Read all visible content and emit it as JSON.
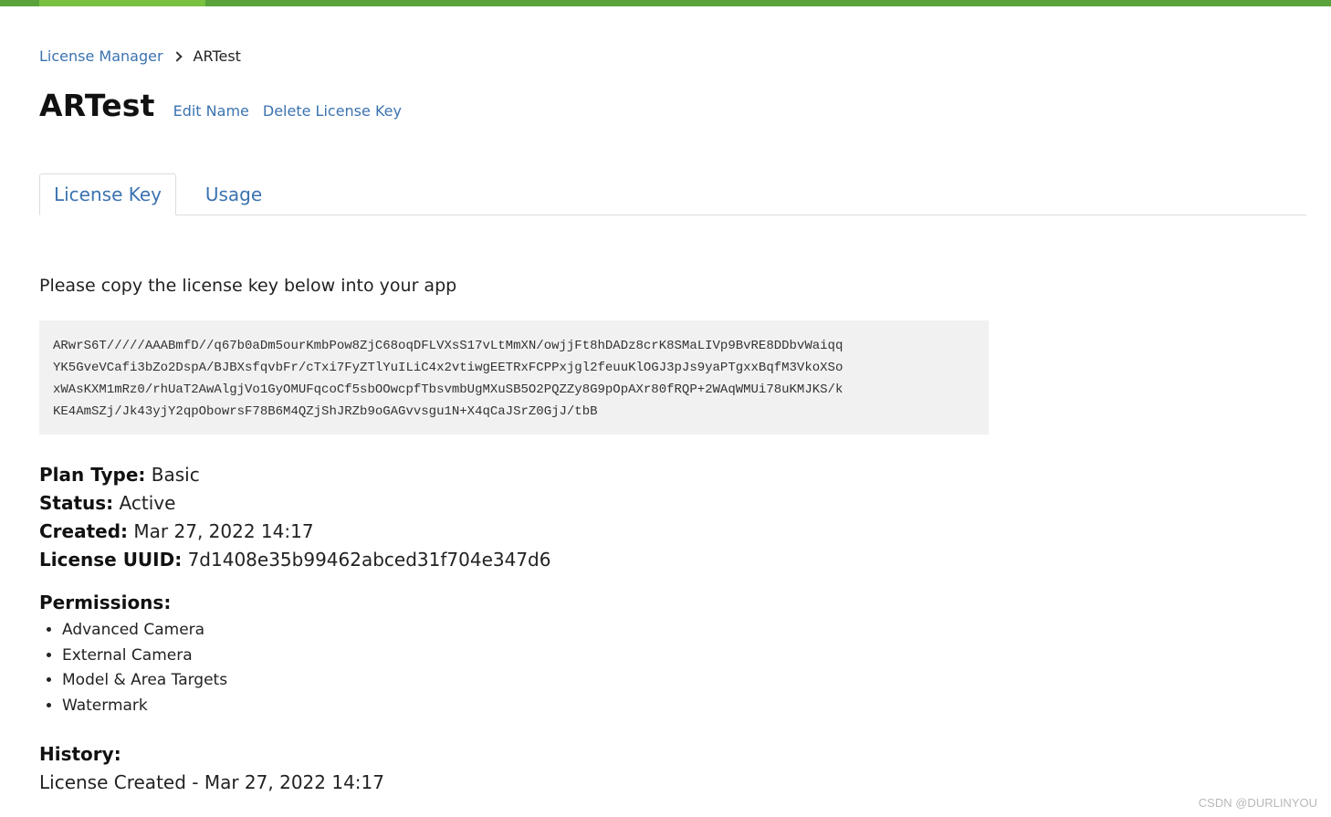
{
  "brand": {
    "accent": "#5aa33c",
    "link": "#3b73b0"
  },
  "breadcrumb": {
    "parent": "License Manager",
    "current": "ARTest"
  },
  "header": {
    "title": "ARTest",
    "edit_label": "Edit Name",
    "delete_label": "Delete License Key"
  },
  "tabs": [
    {
      "label": "License Key",
      "active": true
    },
    {
      "label": "Usage",
      "active": false
    }
  ],
  "license": {
    "instructions": "Please copy the license key below into your app",
    "key_lines": [
      "ARwrS6T/////AAABmfD//q67b0aDm5ourKmbPow8ZjC68oqDFLVXsS17vLtMmXN/owjjFt8hDADz8crK8SMaLIVp9BvRE8DDbvWaiqq",
      "YK5GveVCafi3bZo2DspA/BJBXsfqvbFr/cTxi7FyZTlYuILiC4x2vtiwgEETRxFCPPxjgl2feuuKlOGJ3pJs9yaPTgxxBqfM3VkoXSo",
      "xWAsKXM1mRz0/rhUaT2AwAlgjVo1GyOMUFqcoCf5sbOOwcpfTbsvmbUgMXuSB5O2PQZZy8G9pOpAXr80fRQP+2WAqWMUi78uKMJKS/k",
      "KE4AmSZj/Jk43yjY2qpObowrsF78B6M4QZjShJRZb9oGAGvvsgu1N+X4qCaJSrZ0GjJ/tbB"
    ]
  },
  "details": {
    "plan_type_label": "Plan Type:",
    "plan_type_value": "Basic",
    "status_label": "Status:",
    "status_value": "Active",
    "created_label": "Created:",
    "created_value": "Mar 27, 2022 14:17",
    "uuid_label": "License UUID:",
    "uuid_value": "7d1408e35b99462abced31f704e347d6"
  },
  "permissions": {
    "title": "Permissions:",
    "items": [
      "Advanced Camera",
      "External Camera",
      "Model & Area Targets",
      "Watermark"
    ]
  },
  "history": {
    "title": "History:",
    "entries": [
      "License Created - Mar 27, 2022 14:17"
    ]
  },
  "watermark": "CSDN @DURLINYOU"
}
